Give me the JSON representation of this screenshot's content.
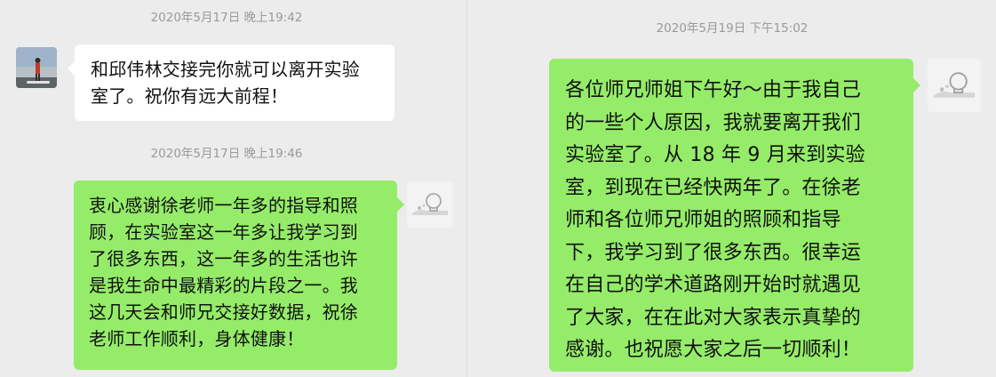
{
  "left_panel": {
    "messages": [
      {
        "timestamp": "2020年5月17日 晚上19:42",
        "sender": "other",
        "text_lines": [
          "和邱伟林交接完你就可以离开实验",
          "室了。祝你有远大前程！"
        ]
      },
      {
        "timestamp": "2020年5月17日 晚上19:46",
        "sender": "self",
        "text_lines": [
          "衷心感谢徐老师一年多的指导和照",
          "顾，在实验室这一年多让我学习到",
          "了很多东西，这一年多的生活也许",
          "是我生命中最精彩的片段之一。我",
          "这几天会和师兄交接好数据，祝徐",
          "老师工作顺利，身体健康！"
        ]
      }
    ]
  },
  "right_panel": {
    "messages": [
      {
        "timestamp": "2020年5月19日 下午15:02",
        "sender": "self",
        "text_lines": [
          "各位师兄师姐下午好～由于我自己",
          "的一些个人原因，我就要离开我们",
          "实验室了。从 18 年 9 月来到实验",
          "室，到现在已经快两年了。在徐老",
          "师和各位师兄师姐的照顾和指导",
          "下，我学习到了很多东西。很幸运",
          "在自己的学术道路刚开始时就遇见",
          "了大家，在在此对大家表示真挚的",
          "感谢。也祝愿大家之后一切顺利！"
        ]
      }
    ]
  },
  "colors": {
    "background": "#ececec",
    "incoming_bubble": "#ffffff",
    "outgoing_bubble": "#95ec69",
    "timestamp_text": "#9a9a9a"
  },
  "icons": {
    "other_avatar": "person-on-paddleboard-photo",
    "self_avatar": "lightbulb-avatar"
  }
}
